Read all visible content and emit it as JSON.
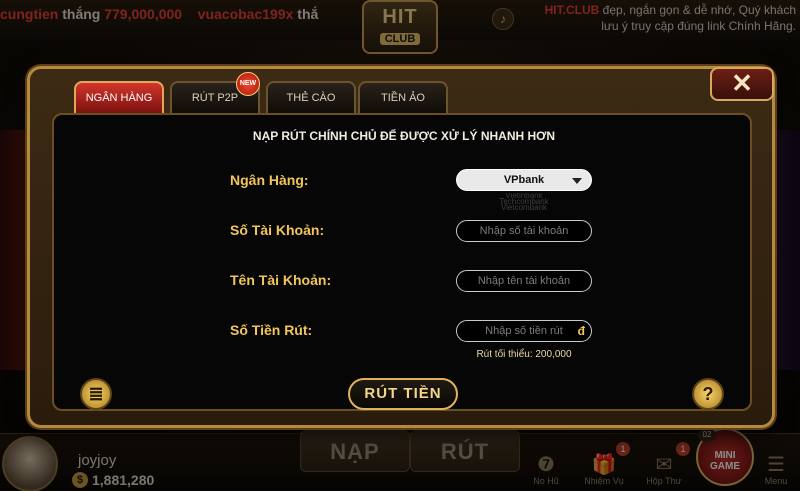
{
  "background": {
    "ticker": [
      {
        "name": "cungtien",
        "verb": "thắng",
        "amount": "779,000,000"
      },
      {
        "name": "vuacobac199x",
        "verb": "thắ",
        "amount": ""
      }
    ],
    "logo": {
      "line1": "HIT",
      "line2": "CLUB"
    },
    "promo": {
      "site": "HIT.CLUB",
      "text1": "đẹp, ngắn gọn & dễ nhớ, Quý khách",
      "text2": "lưu ý truy cập đúng link Chính Hãng."
    },
    "user": {
      "name": "joyjoy",
      "balance": "1,881,280",
      "coin_symbol": "$"
    },
    "buttons": {
      "deposit": "NẠP",
      "withdraw": "RÚT"
    },
    "bottom_items": [
      {
        "label": "No Hũ",
        "icon": "slot-icon",
        "glyph": "❼"
      },
      {
        "label": "Nhiệm Vụ",
        "icon": "gift-icon",
        "glyph": "🎁",
        "badge": "1"
      },
      {
        "label": "Hộp Thư",
        "icon": "mail-icon",
        "glyph": "✉",
        "badge": "1"
      },
      {
        "label": "Menu",
        "icon": "menu-icon",
        "glyph": "☰"
      }
    ],
    "minigame": {
      "label1": "MINI",
      "label2": "GAME",
      "count": "02"
    }
  },
  "modal": {
    "tabs": [
      {
        "label": "NGÂN HÀNG",
        "active": true
      },
      {
        "label": "RÚT P2P",
        "active": false
      },
      {
        "label": "THẺ CÀO",
        "active": false
      },
      {
        "label": "TIỀN ẢO",
        "active": false
      }
    ],
    "new_badge": "NEW",
    "close_glyph": "✕",
    "headline": "NẠP RÚT CHÍNH CHỦ ĐỂ ĐƯỢC XỬ LÝ NHANH HƠN",
    "fields": {
      "bank": {
        "label": "Ngân Hàng:",
        "value": "VPbank",
        "options": [
          "Vietinbank",
          "Techcombank",
          "Vietcombank"
        ]
      },
      "account_number": {
        "label": "Số Tài Khoản:",
        "placeholder": "Nhập số tài khoản"
      },
      "account_name": {
        "label": "Tên Tài Khoản:",
        "placeholder": "Nhập tên tài khoản"
      },
      "amount": {
        "label": "Số Tiền Rút:",
        "placeholder": "Nhập số tiền rút",
        "currency": "đ",
        "min_note": "Rút tối thiểu: 200,000"
      }
    },
    "submit_label": "RÚT TIỀN",
    "left_icon": "≣",
    "help_icon": "?"
  }
}
